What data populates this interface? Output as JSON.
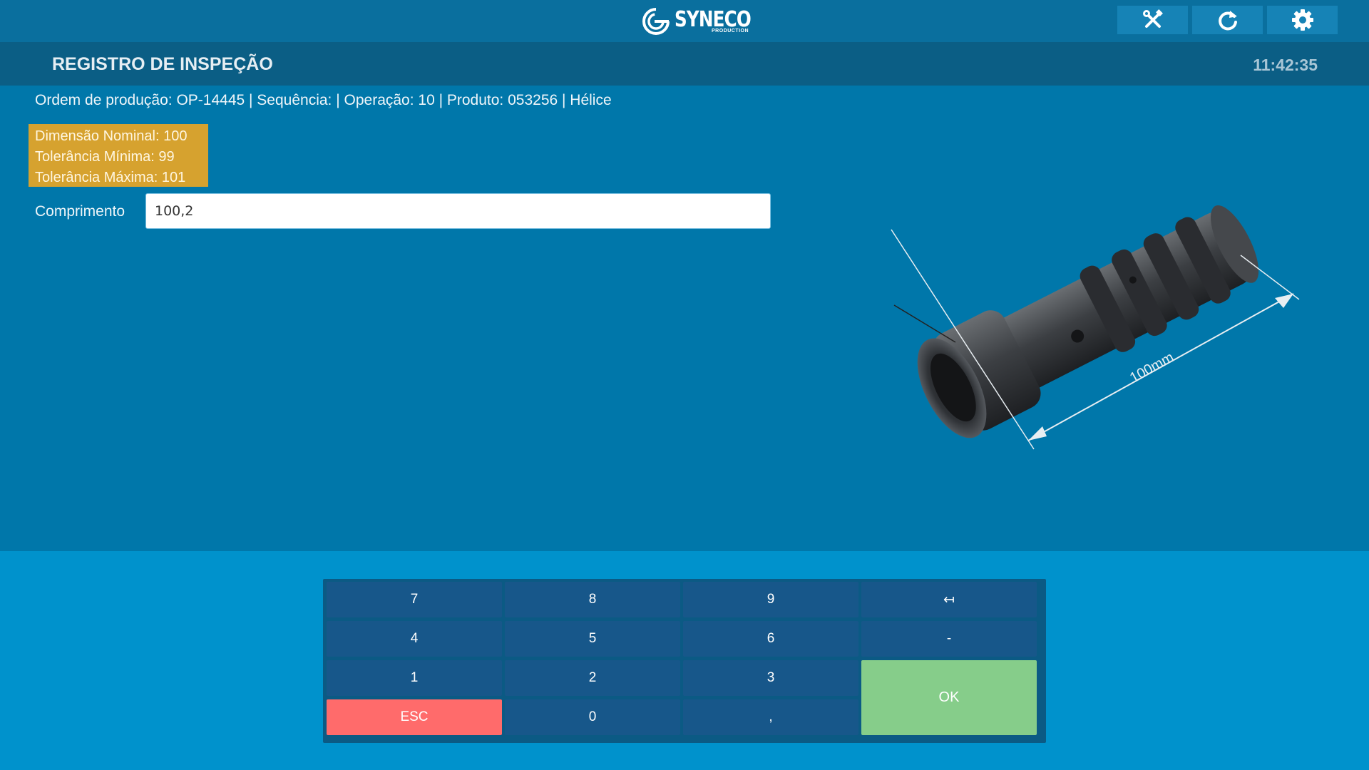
{
  "app": {
    "brand_name": "SYNECO",
    "brand_sub": "PRODUCTION"
  },
  "toolbar": {
    "icons": [
      "tools-icon",
      "refresh-icon",
      "settings-icon"
    ]
  },
  "header": {
    "title": "REGISTRO DE INSPEÇÃO",
    "clock": "11:42:35"
  },
  "order_info": "Ordem de produção: OP-14445 | Sequência: | Operação: 10 | Produto: 053256 | Hélice",
  "tolerance": {
    "nominal": "Dimensão Nominal: 100",
    "min": "Tolerância Mínima: 99",
    "max": "Tolerância Máxima: 101"
  },
  "measurement": {
    "label": "Comprimento",
    "value": "100,2"
  },
  "part_image": {
    "dimension_label": "100mm"
  },
  "keypad": {
    "keys": [
      "7",
      "8",
      "9",
      "↤",
      "4",
      "5",
      "6",
      "-",
      "1",
      "2",
      "3",
      "ESC",
      "0",
      ","
    ],
    "ok": "OK"
  },
  "colors": {
    "background": "#0077aa",
    "tolerance_box": "#d6a22f",
    "esc_key": "#ff6b6b",
    "ok_key": "#86cd8a",
    "key": "#17578a"
  }
}
